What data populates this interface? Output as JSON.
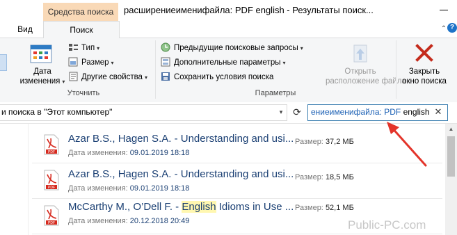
{
  "window": {
    "context_tab": "Средства поиска",
    "title": "расширениеименифайла: PDF english - Результаты поиск..."
  },
  "tabs": [
    {
      "label": "Вид"
    },
    {
      "label": "Поиск"
    }
  ],
  "ribbon": {
    "refine": {
      "date_label_1": "Дата",
      "date_label_2": "изменения",
      "type_label": "Тип",
      "size_label": "Размер",
      "other_label": "Другие свойства",
      "group_label": "Уточнить"
    },
    "options": {
      "recent_label": "Предыдущие поисковые запросы",
      "advanced_label": "Дополнительные параметры",
      "save_label": "Сохранить условия поиска",
      "open_loc_1": "Открыть",
      "open_loc_2": "расположение файла",
      "close_1": "Закрыть",
      "close_2": "окно поиска",
      "group_label": "Параметры"
    }
  },
  "address": {
    "text": "и поиска в \"Этот компьютер\""
  },
  "search": {
    "prefix": "ениеименифайла: PDF",
    "term": "english"
  },
  "results": [
    {
      "name": "Azar B.S., Hagen S.A. - Understanding and usi...",
      "date_label": "Дата изменения:",
      "date": "09.01.2019 18:18",
      "size_label": "Размер:",
      "size": "37,2 МБ"
    },
    {
      "name": "Azar B.S., Hagen S.A. - Understanding and usi...",
      "date_label": "Дата изменения:",
      "date": "09.01.2019 18:18",
      "size_label": "Размер:",
      "size": "18,5 МБ"
    },
    {
      "name_pre": "McCarthy M., O’Dell F. - ",
      "name_hl": "English",
      "name_post": " Idioms in Use ...",
      "date_label": "Дата изменения:",
      "date": "20.12.2018 20:49",
      "size_label": "Размер:",
      "size": "52,1 МБ"
    }
  ],
  "watermark": "Public-PC.com",
  "colors": {
    "context_tab": "#f9d9b7",
    "accent_blue": "#1e73c8",
    "close_red": "#c42b1c",
    "pdf_red": "#d62a1f",
    "arrow_red": "#e3342a",
    "highlight": "#fff7b0"
  }
}
